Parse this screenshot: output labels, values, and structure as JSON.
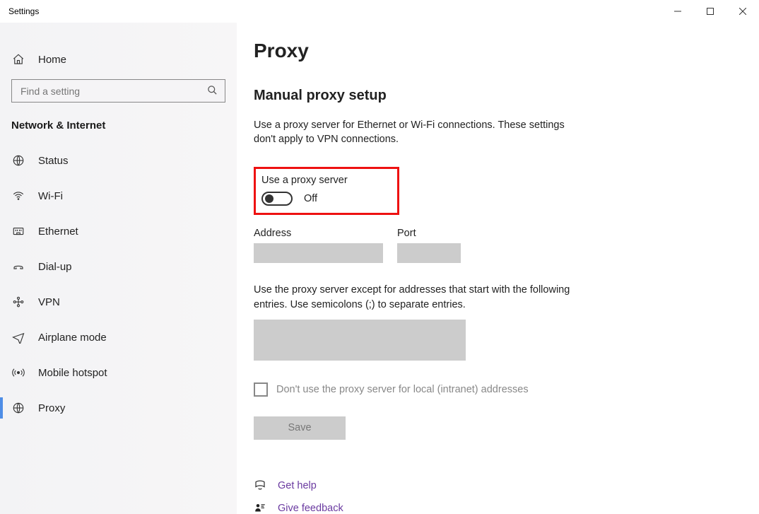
{
  "window": {
    "title": "Settings"
  },
  "sidebar": {
    "home": "Home",
    "search_placeholder": "Find a setting",
    "category": "Network & Internet",
    "items": [
      {
        "label": "Status"
      },
      {
        "label": "Wi-Fi"
      },
      {
        "label": "Ethernet"
      },
      {
        "label": "Dial-up"
      },
      {
        "label": "VPN"
      },
      {
        "label": "Airplane mode"
      },
      {
        "label": "Mobile hotspot"
      },
      {
        "label": "Proxy",
        "selected": true
      }
    ]
  },
  "main": {
    "title": "Proxy",
    "section": "Manual proxy setup",
    "description": "Use a proxy server for Ethernet or Wi-Fi connections. These settings don't apply to VPN connections.",
    "toggle_label": "Use a proxy server",
    "toggle_state": "Off",
    "address_label": "Address",
    "port_label": "Port",
    "address_value": "",
    "port_value": "",
    "exceptions_desc": "Use the proxy server except for addresses that start with the following entries. Use semicolons (;) to separate entries.",
    "exceptions_value": "",
    "local_checkbox_label": "Don't use the proxy server for local (intranet) addresses",
    "save_label": "Save",
    "help_link": "Get help",
    "feedback_link": "Give feedback"
  }
}
